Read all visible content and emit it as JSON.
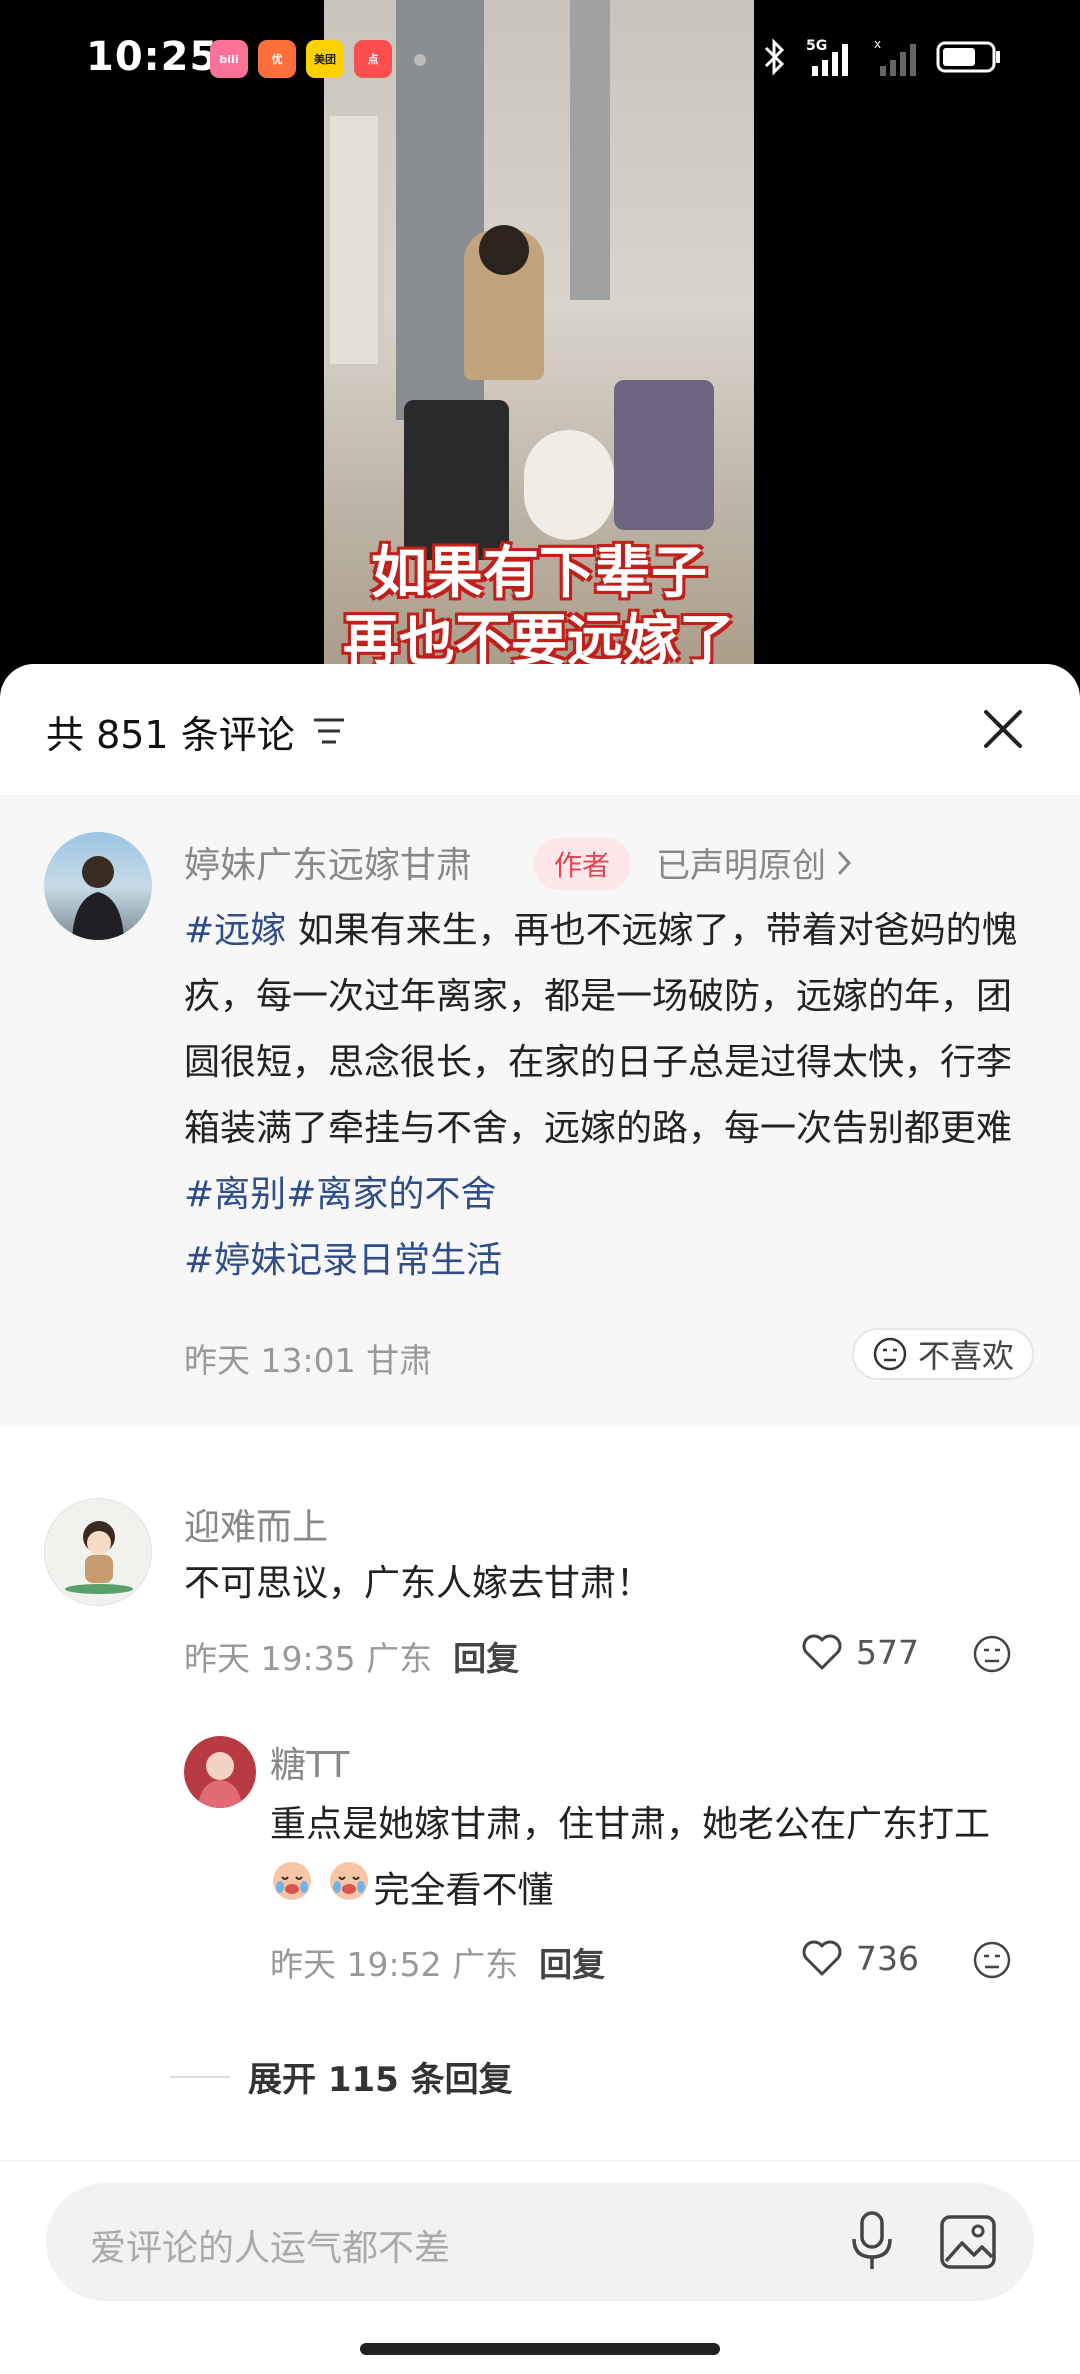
{
  "status_bar": {
    "time": "10:25",
    "apps": [
      {
        "name": "bilibili",
        "label": "bili",
        "color": "#fb7299"
      },
      {
        "name": "meituan-youxuan",
        "label": "优",
        "color": "#ff6f3c"
      },
      {
        "name": "meituan",
        "label": "美团",
        "color": "#ffd000"
      },
      {
        "name": "dianping",
        "label": "点",
        "color": "#ff4e4e"
      }
    ],
    "network": "5G"
  },
  "video": {
    "overlay_line1": "如果有下辈子",
    "overlay_line2": "再也不要远嫁了"
  },
  "sheet": {
    "title": "共 851 条评论"
  },
  "author_comment": {
    "name": "婷妹广东远嫁甘肃",
    "tag": "作者",
    "declared": "已声明原创",
    "tag1": "#远嫁",
    "text1": " 如果有来生，再也不远嫁了，带着对爸妈的愧疚，每一次过年离家，都是一场破防，远嫁的年，团圆很短，思念很长，在家的日子总是过得太快，行李箱装满了牵挂与不舍，远嫁的路，每一次告别都更难",
    "tag2": "#离别",
    "tag3": "#离家的不舍",
    "tag4": "#婷妹记录日常生活",
    "time": "昨天 13:01",
    "location": "甘肃",
    "dislike": "不喜欢"
  },
  "comments": [
    {
      "name": "迎难而上",
      "text": "不可思议，广东人嫁去甘肃！",
      "time": "昨天 19:35",
      "location": "广东",
      "reply": "回复",
      "likes": "577"
    }
  ],
  "replies": [
    {
      "name": "糖TT",
      "text": "重点是她嫁甘肃，住甘肃，她老公在广东打工",
      "text_after": "完全看不懂",
      "time": "昨天 19:52",
      "location": "广东",
      "reply": "回复",
      "likes": "736"
    }
  ],
  "expand": "展开 115 条回复",
  "input": {
    "placeholder": "爱评论的人运气都不差"
  }
}
